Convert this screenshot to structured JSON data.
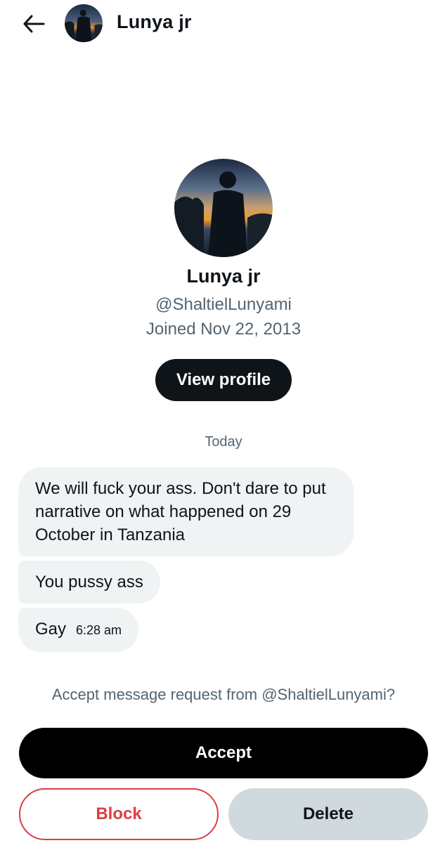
{
  "header": {
    "back_icon": "arrow-left-icon",
    "title": "Lunya jr"
  },
  "profile": {
    "name": "Lunya jr",
    "handle": "@ShaltielLunyami",
    "joined": "Joined Nov 22, 2013",
    "view_profile_label": "View profile"
  },
  "conversation": {
    "day_label": "Today",
    "messages": [
      {
        "text": "We will fuck your ass. Don't dare to put narrative on what happened on 29 October in Tanzania"
      },
      {
        "text": "You pussy ass"
      },
      {
        "text": "Gay",
        "time": "6:28 am"
      }
    ]
  },
  "request": {
    "prompt": "Accept message request from @ShaltielLunyami?",
    "accept_label": "Accept",
    "block_label": "Block",
    "delete_label": "Delete"
  },
  "colors": {
    "primary_text": "#0f1419",
    "secondary_text": "#536471",
    "bubble_bg": "#eff3f4",
    "block_red": "#dc3d46",
    "delete_bg": "#cfd9de"
  }
}
